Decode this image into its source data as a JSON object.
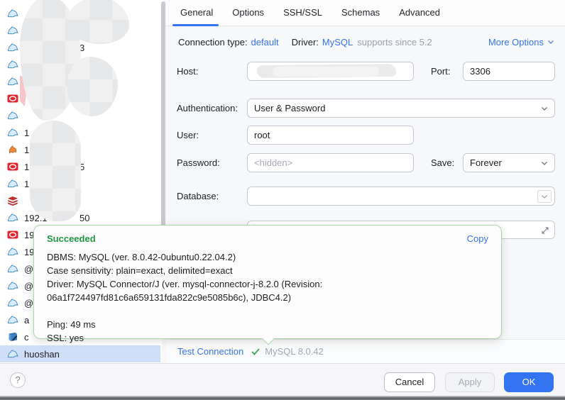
{
  "tabs": {
    "items": [
      {
        "label": "General",
        "active": true
      },
      {
        "label": "Options",
        "active": false
      },
      {
        "label": "SSH/SSL",
        "active": false
      },
      {
        "label": "Schemas",
        "active": false
      },
      {
        "label": "Advanced",
        "active": false
      }
    ]
  },
  "toolbar": {
    "connection_type_label": "Connection type:",
    "connection_type_value": "default",
    "driver_label": "Driver:",
    "driver_value": "MySQL",
    "driver_note": "supports since 5.2",
    "more_options_label": "More Options"
  },
  "form": {
    "host_label": "Host:",
    "host_value": "",
    "port_label": "Port:",
    "port_value": "3306",
    "auth_label": "Authentication:",
    "auth_value": "User & Password",
    "user_label": "User:",
    "user_value": "root",
    "password_label": "Password:",
    "password_placeholder": "<hidden>",
    "save_label": "Save:",
    "save_value": "Forever",
    "database_label": "Database:",
    "database_value": ""
  },
  "result_popup": {
    "title": "Succeeded",
    "copy_label": "Copy",
    "lines": [
      "DBMS: MySQL (ver. 8.0.42-0ubuntu0.22.04.2)",
      "Case sensitivity: plain=exact, delimited=exact",
      "Driver: MySQL Connector/J (ver. mysql-connector-j-8.2.0 (Revision:",
      "06a1f724497fd81c6a659131fda822c9e5085b6c), JDBC4.2)",
      "",
      "Ping: 49 ms",
      "SSL: yes"
    ]
  },
  "status_bar": {
    "test_connection_label": "Test Connection",
    "server_version": "MySQL 8.0.42"
  },
  "buttons": {
    "cancel": "Cancel",
    "apply": "Apply",
    "ok": "OK"
  },
  "help": {
    "label": "?"
  },
  "sidebar": {
    "items": [
      {
        "icon": "mysql",
        "pre": "",
        "suf": "",
        "selected": false
      },
      {
        "icon": "mysql",
        "pre": "",
        "suf": "",
        "selected": false
      },
      {
        "icon": "mysql",
        "pre": "",
        "suf": "3",
        "selected": false
      },
      {
        "icon": "mysql",
        "pre": "",
        "suf": "",
        "selected": false
      },
      {
        "icon": "mysql",
        "pre": "",
        "suf": "",
        "selected": false
      },
      {
        "icon": "oracle",
        "pre": "",
        "suf": "",
        "selected": false
      },
      {
        "icon": "mysql",
        "pre": "",
        "suf": "",
        "selected": false
      },
      {
        "icon": "mysql",
        "pre": "1",
        "suf": "",
        "selected": false
      },
      {
        "icon": "generic-orange",
        "pre": "1",
        "suf": "",
        "selected": false
      },
      {
        "icon": "oracle",
        "pre": "1",
        "suf": "5",
        "selected": false
      },
      {
        "icon": "mysql",
        "pre": "1",
        "suf": "",
        "selected": false
      },
      {
        "icon": "redis",
        "pre": "",
        "suf": "",
        "selected": false
      },
      {
        "icon": "mysql",
        "pre": "192.1",
        "suf": "50",
        "selected": false
      },
      {
        "icon": "oracle",
        "pre": "19",
        "suf": "",
        "selected": false
      },
      {
        "icon": "mysql",
        "pre": "19",
        "suf": "",
        "selected": false
      },
      {
        "icon": "mysql",
        "pre": "@",
        "suf": "",
        "selected": false
      },
      {
        "icon": "mysql",
        "pre": "@",
        "suf": "",
        "selected": false
      },
      {
        "icon": "mysql",
        "pre": "@",
        "suf": "",
        "selected": false
      },
      {
        "icon": "mysql",
        "pre": "a",
        "suf": "",
        "selected": false
      },
      {
        "icon": "notebook",
        "pre": "c",
        "suf": "",
        "selected": false
      },
      {
        "icon": "mysql",
        "pre": "huoshan",
        "suf": "",
        "selected": true
      }
    ]
  },
  "colors": {
    "accent_blue": "#3574f0",
    "success_green": "#1d9642",
    "popup_border": "#abd5ab",
    "selection_blue": "#cfdff8"
  }
}
